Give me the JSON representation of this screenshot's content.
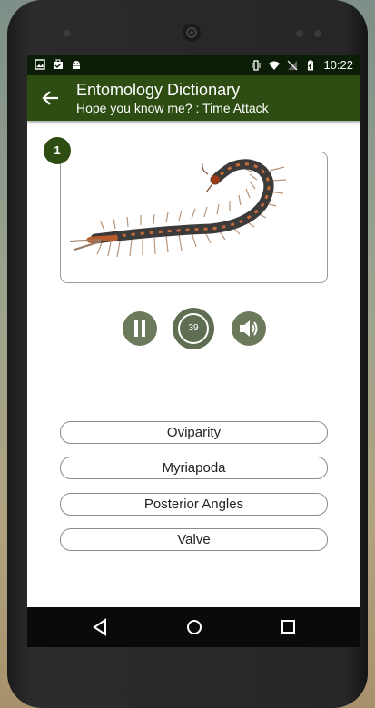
{
  "status_bar": {
    "time": "10:22"
  },
  "app_bar": {
    "title": "Entomology Dictionary",
    "subtitle": "Hope you know me? : Time Attack"
  },
  "question": {
    "number": "1",
    "image_subject": "centipede"
  },
  "controls": {
    "timer_value": "39"
  },
  "options": [
    "Oviparity",
    "Myriapoda",
    "Posterior Angles",
    "Valve"
  ],
  "colors": {
    "app_bar": "#2e4d12",
    "status_bar": "#0b1d06",
    "control_button": "#6a7a5a"
  }
}
